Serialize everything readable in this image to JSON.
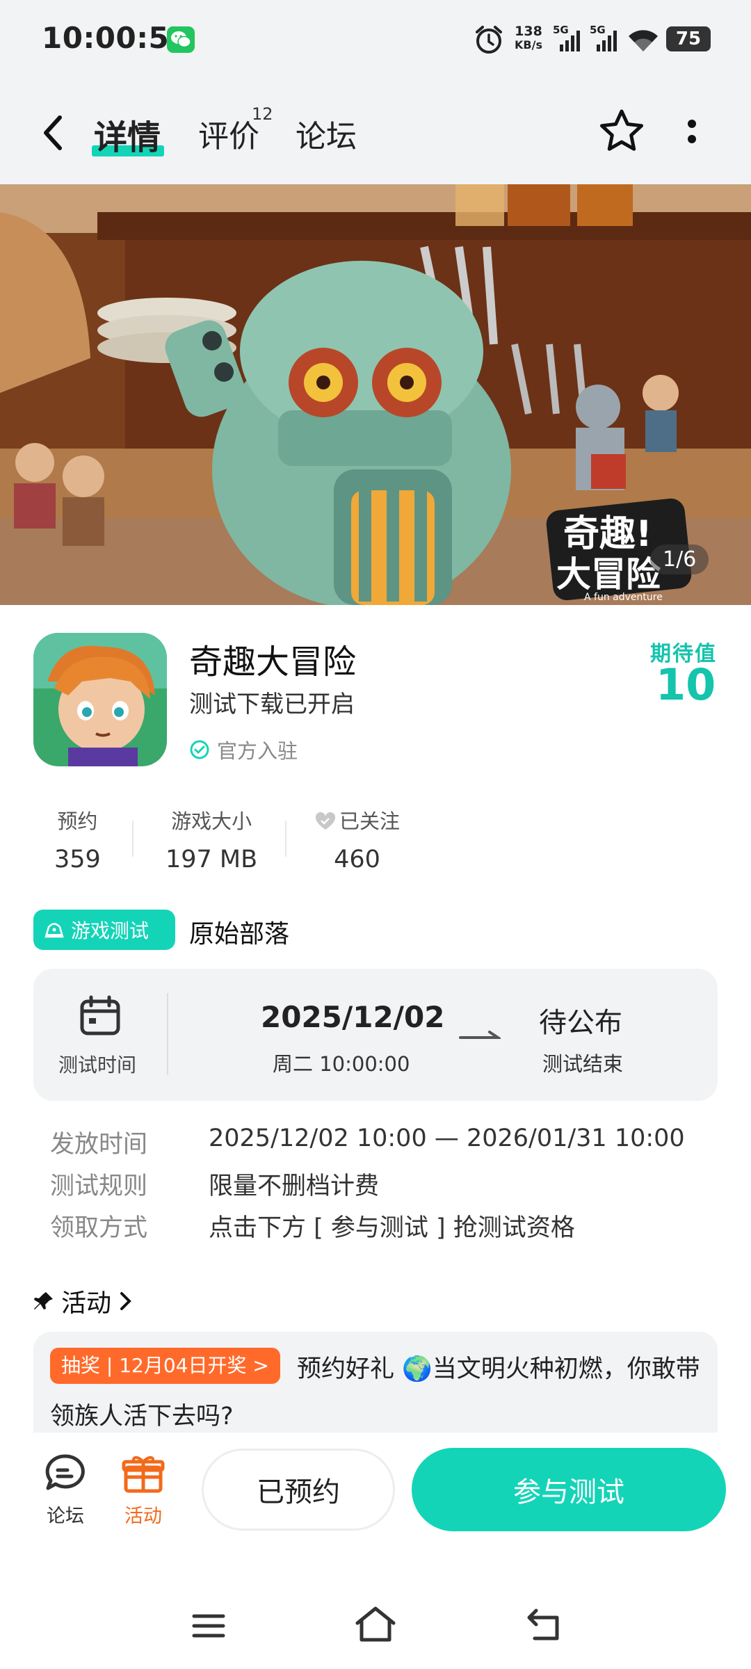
{
  "status_bar": {
    "time": "10:00:57",
    "net_speed_value": "138",
    "net_speed_unit": "KB/s",
    "signal1_label": "5G",
    "signal2_label": "5G",
    "battery": "75"
  },
  "nav": {
    "tabs": [
      {
        "label": "详情",
        "active": true
      },
      {
        "label": "评价",
        "badge": "12"
      },
      {
        "label": "论坛"
      }
    ]
  },
  "banner": {
    "counter": "1/6",
    "logo_text_line1": "奇趣!",
    "logo_text_line2": "大冒险",
    "logo_subtitle": "A fun adventure"
  },
  "app": {
    "name": "奇趣大冒险",
    "subtitle": "测试下载已开启",
    "official_label": "官方入驻",
    "expect_label": "期待值",
    "expect_value": "10"
  },
  "stats": [
    {
      "label": "预约",
      "value": "359"
    },
    {
      "label": "游戏大小",
      "value": "197 MB"
    },
    {
      "label": "已关注",
      "value": "460"
    }
  ],
  "test": {
    "tag": "游戏测试",
    "title": "原始部落",
    "time_label": "测试时间",
    "start_date": "2025/12/02",
    "start_time": "周二  10:00:00",
    "end_status": "待公布",
    "end_label": "测试结束",
    "details": [
      {
        "key": "发放时间",
        "value": "2025/12/02 10:00 — 2026/01/31 10:00"
      },
      {
        "key": "测试规则",
        "value": "限量不删档计费"
      },
      {
        "key": "领取方式",
        "value": "点击下方 [ 参与测试 ] 抢测试资格"
      }
    ]
  },
  "activity": {
    "header": "活动",
    "badge": "抽奖 | 12月04日开奖 >",
    "text": "预约好礼 🌍当文明火种初燃，你敢带领族人活下去吗?"
  },
  "bottom_bar": {
    "forum_label": "论坛",
    "activity_label": "活动",
    "reserved_button": "已预约",
    "join_button": "参与测试"
  },
  "colors": {
    "accent": "#14d4b8",
    "activity_orange": "#f26a1b",
    "badge_orange": "#ff6a2b"
  }
}
